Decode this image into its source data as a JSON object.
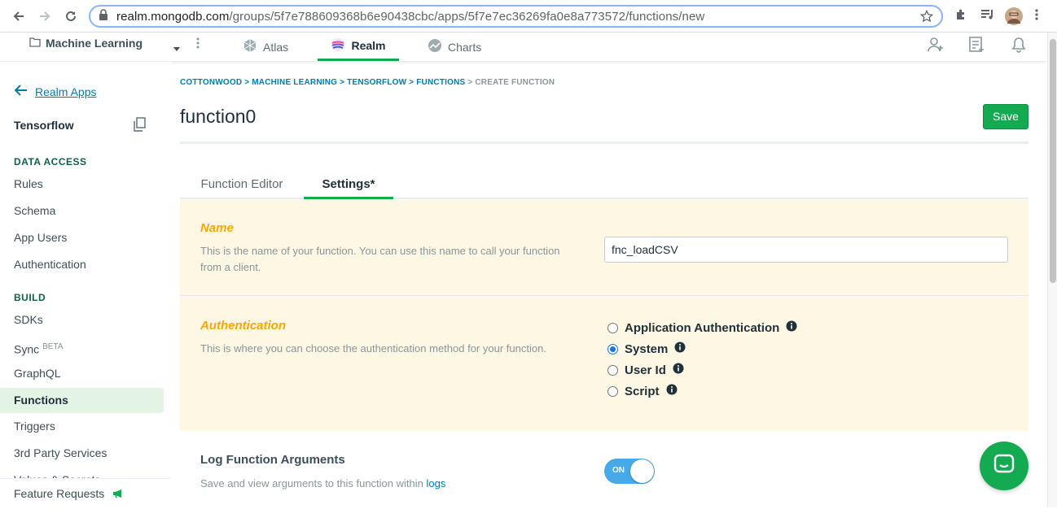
{
  "browser": {
    "url_host": "realm.mongodb.com",
    "url_path": "/groups/5f7e788609368b6e90438cbc/apps/5f7e7ec36269fa0e8a773572/functions/new"
  },
  "topnav": {
    "project": "Machine Learning",
    "tabs": [
      {
        "label": "Atlas"
      },
      {
        "label": "Realm"
      },
      {
        "label": "Charts"
      }
    ]
  },
  "sidebar": {
    "back_label": "Realm Apps",
    "app_name": "Tensorflow",
    "sections": {
      "data_access": "DATA ACCESS",
      "build": "BUILD"
    },
    "data_access_items": [
      "Rules",
      "Schema",
      "App Users",
      "Authentication"
    ],
    "build_items": [
      "SDKs",
      "Sync",
      "GraphQL",
      "Functions",
      "Triggers",
      "3rd Party Services",
      "Values & Secrets"
    ],
    "sync_badge": "BETA",
    "feature_requests": "Feature Requests"
  },
  "breadcrumb": {
    "items": [
      "COTTONWOOD",
      "MACHINE LEARNING",
      "TENSORFLOW",
      "FUNCTIONS"
    ],
    "current": "CREATE FUNCTION",
    "separator": " > "
  },
  "page": {
    "title": "function0",
    "save_label": "Save"
  },
  "tabs": {
    "editor": "Function Editor",
    "settings": "Settings*"
  },
  "name_section": {
    "title": "Name",
    "description": "This is the name of your function. You can use this name to call your function from a client.",
    "value": "fnc_loadCSV"
  },
  "auth_section": {
    "title": "Authentication",
    "description": "This is where you can choose the authentication method for your function.",
    "options": [
      {
        "label": "Application Authentication",
        "selected": false
      },
      {
        "label": "System",
        "selected": true
      },
      {
        "label": "User Id",
        "selected": false
      },
      {
        "label": "Script",
        "selected": false
      }
    ]
  },
  "log_section": {
    "title": "Log Function Arguments",
    "description": "Save and view arguments to this function within",
    "link": "logs",
    "toggle_label": "ON",
    "toggle_on": true
  },
  "colors": {
    "brand_green": "#13aa52",
    "link_blue": "#007cad",
    "section_title": "#f5a900",
    "panel_bg": "#fef7e3",
    "toggle_blue": "#47a9e8"
  }
}
